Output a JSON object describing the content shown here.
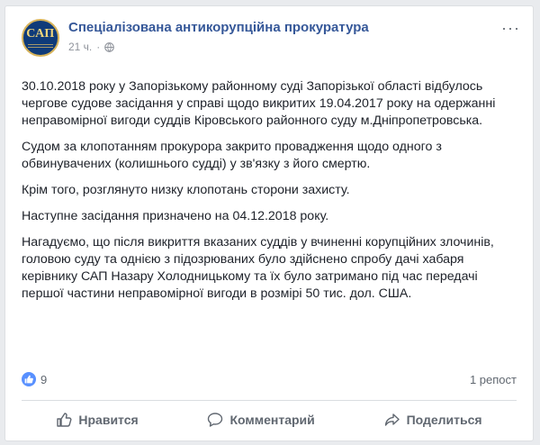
{
  "post": {
    "page_name": "Спеціалізована антикорупційна прокуратура",
    "avatar_abbr": "САП",
    "time": "21 ч.",
    "separator": "·",
    "privacy_icon": "globe-icon",
    "menu_icon": "more-options-icon",
    "menu_label": "···",
    "paragraphs": [
      "30.10.2018 року у Запорізькому районному суді Запорізької області відбулось чергове судове засідання у справі щодо викритих 19.04.2017 року на одержанні неправомірної вигоди суддів Кіровського районного суду м.Дніпропетровська.",
      "Судом за клопотанням прокурора закрито провадження щодо одного з обвинувачених (колишнього судді) у зв'язку з його смертю.",
      "Крім того, розглянуто низку клопотань сторони захисту.",
      "Наступне засідання призначено на 04.12.2018 року.",
      "Нагадуємо, що після викриття вказаних суддів у вчиненні корупційних злочинів, головою суду та однією з підозрюваних було здійснено спробу дачі хабаря керівнику САП Назару Холодницькому та їх було затримано під час передачі першої частини неправомірної вигоди в розмірі 50 тис. дол. США."
    ]
  },
  "stats": {
    "like_count": "9",
    "reposts": "1 репост"
  },
  "actions": {
    "like": "Нравится",
    "comment": "Комментарий",
    "share": "Поделиться"
  },
  "colors": {
    "link": "#365899",
    "like_badge": "#5890ff",
    "text": "#1d2129",
    "muted": "#606770"
  }
}
